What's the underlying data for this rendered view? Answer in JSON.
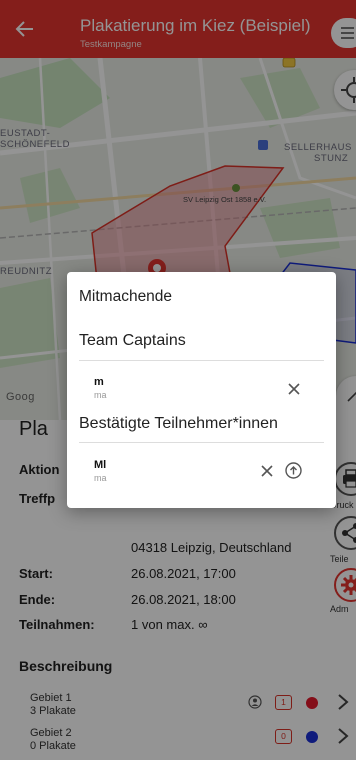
{
  "header": {
    "title": "Plakatierung im Kiez (Beispiel)",
    "subtitle": "Testkampagne",
    "back_icon": "arrow-left-icon",
    "menu_icon": "menu-icon"
  },
  "map": {
    "labels": {
      "eustadt": "EUSTADT-",
      "schonefeld": "SCHÖNEFELD",
      "sellerhaus": "SELLERHAUS",
      "stunz": "STUNZ",
      "sv_leipzig": "SV Leipzig Ost 1858 e.V.",
      "reudnitz": "REUDNITZ",
      "google": "Goog"
    },
    "locate_icon": "my-location-icon"
  },
  "info": {
    "title": "Pla",
    "aktion_label": "Aktion",
    "treffp_label": "Treffp",
    "address": "04318 Leipzig, Deutschland",
    "start_label": "Start:",
    "start_value": "26.08.2021, 17:00",
    "ende_label": "Ende:",
    "ende_value": "26.08.2021, 18:00",
    "teilnahmen_label": "Teilnahmen:",
    "teilnahmen_value": "1 von max. ∞",
    "beschreibung": "Beschreibung"
  },
  "areas": [
    {
      "name": "Gebiet 1",
      "count": "3 Plakate",
      "badge": "1",
      "color": "#e3192b"
    },
    {
      "name": "Gebiet 2",
      "count": "0 Plakate",
      "badge": "0",
      "color": "#1a2fd6"
    }
  ],
  "side_actions": {
    "druck": "Druck",
    "teile": "Teile",
    "adm": "Adm"
  },
  "dialog": {
    "title": "Mitmachende",
    "captains_heading": "Team Captains",
    "captain": {
      "name": "m",
      "mail": "ma"
    },
    "confirmed_heading": "Bestätigte Teilnehmer*innen",
    "participant": {
      "name": "Ml",
      "mail": "ma"
    }
  },
  "colors": {
    "accent": "#e3342f",
    "area_outline": "#d93228"
  }
}
